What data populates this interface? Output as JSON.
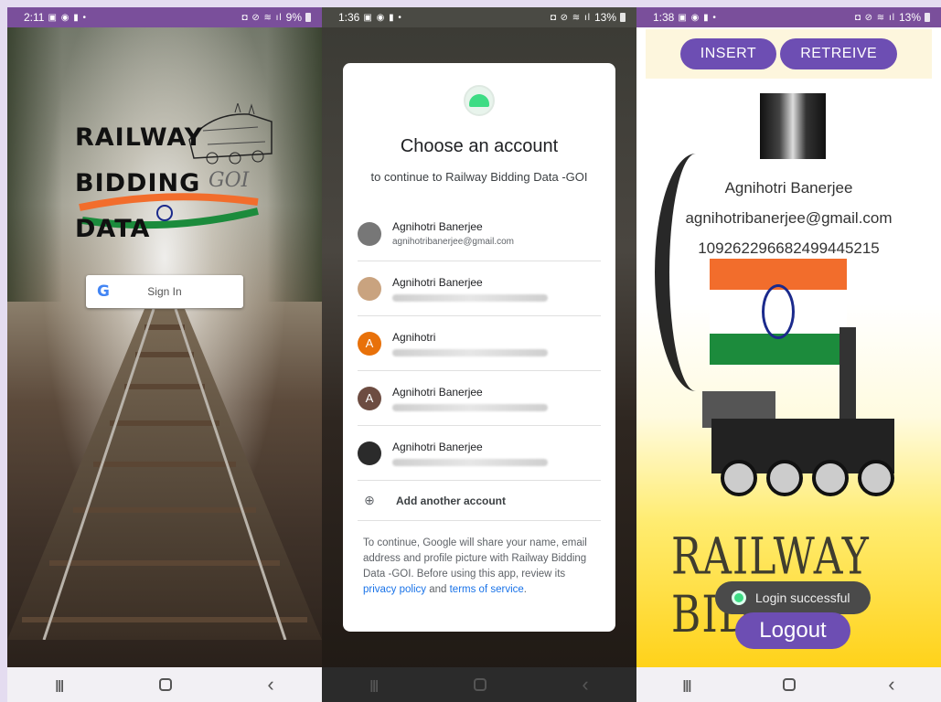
{
  "screen1": {
    "status": {
      "time": "2:11",
      "battery": "9%"
    },
    "logo": {
      "line1": "RAILWAY",
      "line2": "BIDDING",
      "line3": "DATA",
      "goi": "GOI"
    },
    "signin": {
      "label": "Sign In",
      "google_glyph": "G"
    }
  },
  "screen2": {
    "status": {
      "time": "1:36",
      "battery": "13%"
    },
    "title": "Choose an account",
    "subtitle": "to continue to Railway Bidding Data -GOI",
    "accounts": [
      {
        "name": "Agnihotri Banerjee",
        "email": "agnihotribanerjee@gmail.com",
        "avatar": "",
        "avatar_color": "#777777"
      },
      {
        "name": "Agnihotri Banerjee",
        "email": "",
        "avatar": "",
        "avatar_color": "#c9a37f"
      },
      {
        "name": "Agnihotri",
        "email": "",
        "avatar": "A",
        "avatar_color": "#e8710a"
      },
      {
        "name": "Agnihotri Banerjee",
        "email": "",
        "avatar": "A",
        "avatar_color": "#6d4c41"
      },
      {
        "name": "Agnihotri Banerjee",
        "email": "",
        "avatar": "",
        "avatar_color": "#2b2b2b"
      }
    ],
    "add_account": "Add another account",
    "disclaimer_prefix": "To continue, Google will share your name, email address and profile picture with Railway Bidding Data -GOI. Before using this app, review its ",
    "privacy_link": "privacy policy",
    "and_text": " and ",
    "terms_link": "terms of service",
    "period": "."
  },
  "screen3": {
    "status": {
      "time": "1:38",
      "battery": "13%"
    },
    "insert_label": "INSERT",
    "retrieve_label": "RETREIVE",
    "user_name": "Agnihotri Banerjee",
    "user_email": "agnihotribanerjee@gmail.com",
    "user_id": "109262296682499445215",
    "bids_text": "RAILWAY BIDS",
    "toast": "Login successful",
    "logout_label": "Logout"
  },
  "colors": {
    "accent_purple": "#6d4eb3",
    "status_purple": "#7a4f9b",
    "link_blue": "#1a73e8",
    "saffron": "#f26d2c",
    "india_green": "#1c8b3c"
  }
}
